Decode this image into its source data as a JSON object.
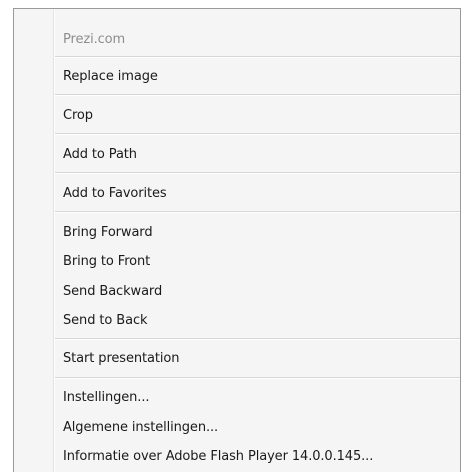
{
  "context_menu": {
    "header": "Prezi.com",
    "items": [
      {
        "label": "Replace image"
      },
      {
        "label": "Crop"
      },
      {
        "label": "Add to Path"
      },
      {
        "label": "Add to Favorites"
      },
      {
        "label": "Bring Forward"
      },
      {
        "label": "Bring to Front"
      },
      {
        "label": "Send Backward"
      },
      {
        "label": "Send to Back"
      },
      {
        "label": "Start presentation"
      },
      {
        "label": "Instellingen..."
      },
      {
        "label": "Algemene instellingen..."
      },
      {
        "label": "Informatie over Adobe Flash Player 14.0.0.145..."
      }
    ]
  }
}
